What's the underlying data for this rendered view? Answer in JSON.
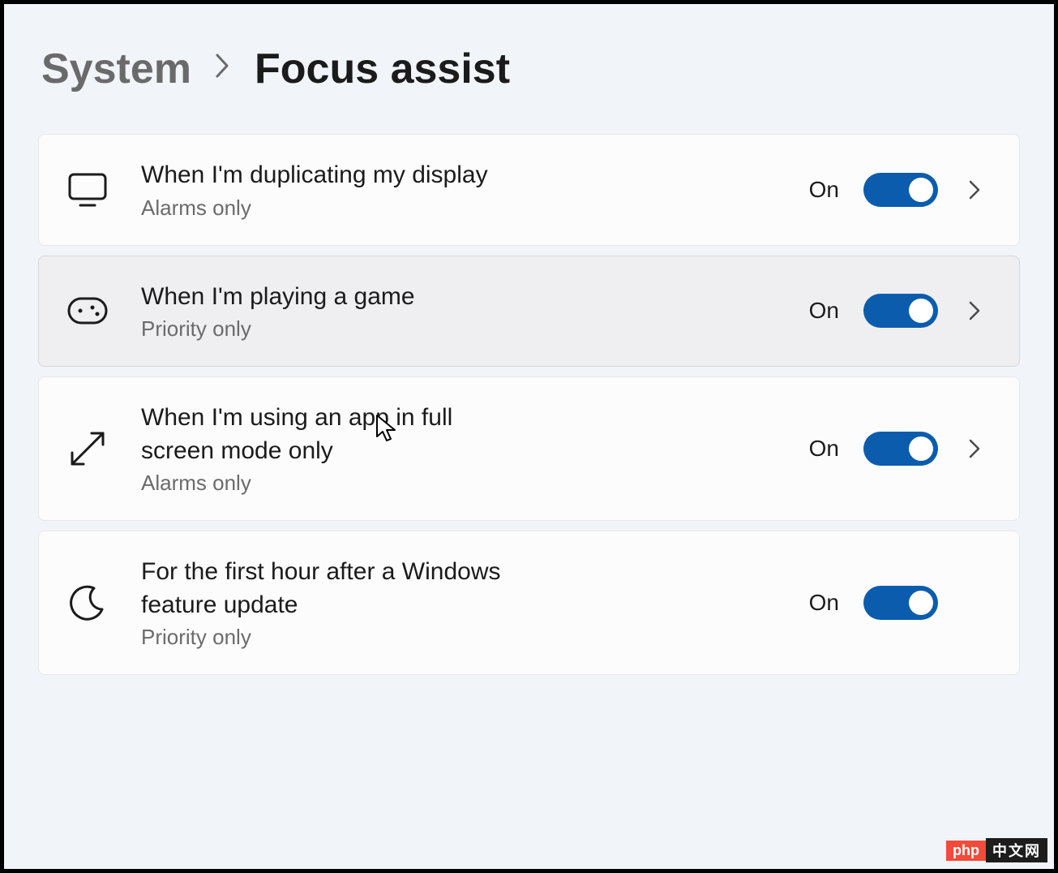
{
  "breadcrumb": {
    "parent": "System",
    "current": "Focus assist"
  },
  "rows": [
    {
      "icon": "monitor-icon",
      "title": "When I'm duplicating my display",
      "subtitle": "Alarms only",
      "state_label": "On",
      "on": true,
      "has_chevron": true
    },
    {
      "icon": "gamepad-icon",
      "title": "When I'm playing a game",
      "subtitle": "Priority only",
      "state_label": "On",
      "on": true,
      "has_chevron": true,
      "hover": true
    },
    {
      "icon": "fullscreen-icon",
      "title": "When I'm using an app in full screen mode only",
      "subtitle": "Alarms only",
      "state_label": "On",
      "on": true,
      "has_chevron": true
    },
    {
      "icon": "moon-icon",
      "title": "For the first hour after a Windows feature update",
      "subtitle": "Priority only",
      "state_label": "On",
      "on": true,
      "has_chevron": false
    }
  ],
  "watermark": {
    "left": "php",
    "right": "中文网"
  },
  "colors": {
    "accent": "#0b5cad",
    "bg": "#f1f4f9"
  }
}
